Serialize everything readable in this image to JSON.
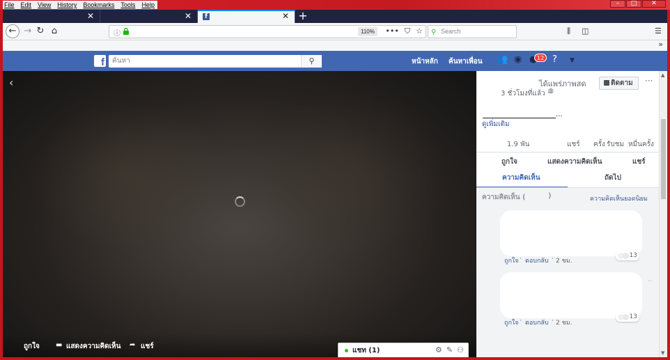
{
  "menu": [
    "File",
    "Edit",
    "View",
    "History",
    "Bookmarks",
    "Tools",
    "Help"
  ],
  "window_controls": {
    "minimize": "–",
    "maximize": "□",
    "close": "✕"
  },
  "tabs": [
    {
      "title": "",
      "close": "✕",
      "active": false
    },
    {
      "title": "",
      "close": "✕",
      "active": false
    },
    {
      "title": "",
      "close": "✕",
      "active": true,
      "favicon": "f"
    }
  ],
  "new_tab": "+",
  "nav": {
    "back": "←",
    "forward": "→",
    "reload": "↻",
    "home": "⌂",
    "url": "",
    "zoom": "110%",
    "search_placeholder": "Search",
    "more": "•••"
  },
  "fb": {
    "logo": "f",
    "search_placeholder": "ค้นหา",
    "home": "หน้าหลัก",
    "find_friends": "ค้นหาเพื่อน",
    "notif_count": "12"
  },
  "video": {
    "actions": {
      "like": "ถูกใจ",
      "comment": "แสดงความคิดเห็น",
      "share": "แชร์"
    }
  },
  "chat": {
    "label": "แชท (1)"
  },
  "panel": {
    "live_text": "ได้แพร่ภาพสด",
    "time": "3 ชั่วโมงที่แล้ว ·",
    "follow": "ติดตาม",
    "more": "···",
    "ellipsis": "...",
    "see_more": "ดูเพิ่มเติม",
    "stats": {
      "likes": "1.9 พัน",
      "shares": "แชร์",
      "times": "ครั้ง",
      "views": "รับชม",
      "tenk": "หมื่น",
      "times2": "ครั้ง"
    },
    "actions": {
      "like": "ถูกใจ",
      "comment": "แสดงความคิดเห็น",
      "share": "แชร์"
    },
    "tabs": {
      "comments": "ความคิดเห็น",
      "next": "ถัดไป"
    },
    "comments_header": "ความคิดเห็น (",
    "comments_header_close": ")",
    "top_comments": "ความคิดเห็นยอดนิยม",
    "comments": [
      {
        "like": "ถูกใจ",
        "reply": "ตอบกลับ",
        "time": "2 ชม.",
        "reactions": "13"
      },
      {
        "like": "ถูกใจ",
        "reply": "ตอบกลับ",
        "time": "2 ชม.",
        "reactions": "13"
      }
    ]
  }
}
